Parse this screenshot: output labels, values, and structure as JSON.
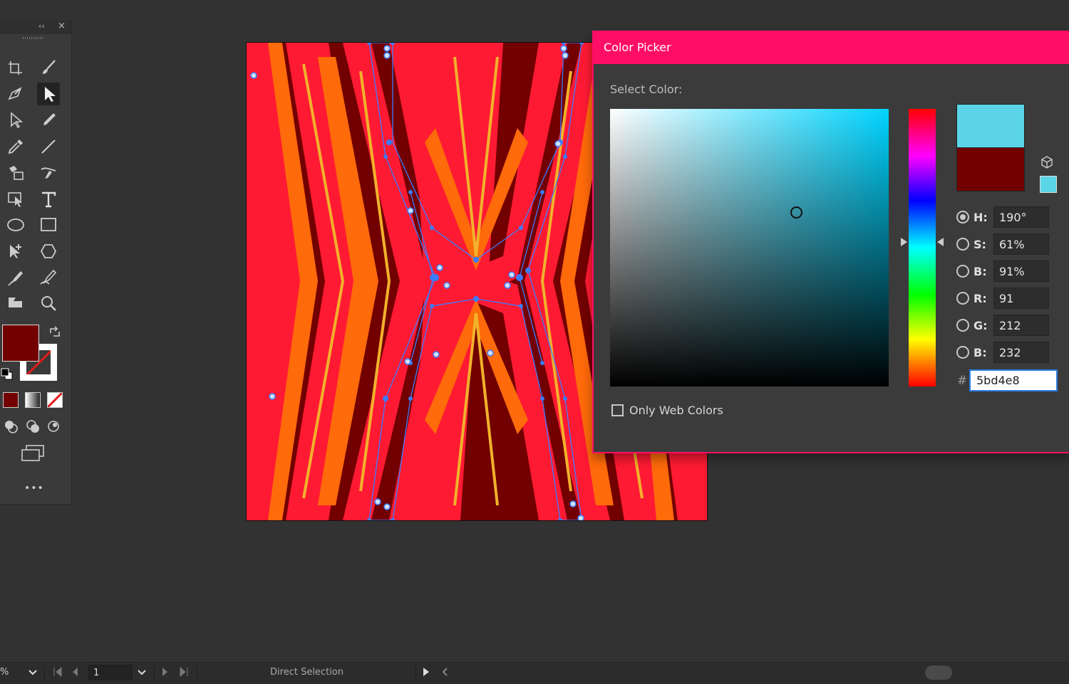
{
  "toolbar": {
    "collapse_label": "‹‹",
    "close_label": "×",
    "more_label": "•••",
    "fill_color": "#720000",
    "stroke_color": "none",
    "tools": [
      "artboard-tool",
      "paintbrush-tool",
      "shaper-tool",
      "direct-selection-tool",
      "selection-tool",
      "pencil-tool",
      "eyedropper-tool",
      "line-tool",
      "live-paint-tool",
      "curvature-tool",
      "free-transform-tool",
      "type-tool",
      "ellipse-tool",
      "rectangle-tool",
      "anchor-point-tool",
      "polygon-tool",
      "pen-tool",
      "width-tool",
      "graph-tool",
      "zoom-tool"
    ]
  },
  "artboard": {
    "colors": {
      "background": "#720000",
      "primary": "#ff1a33",
      "secondary": "#ff6a0a",
      "accent": "#f2b12b",
      "path_handle": "#3b7cff"
    }
  },
  "color_picker": {
    "title": "Color Picker",
    "select_label": "Select Color:",
    "new_color": "#5bd4e8",
    "original_color": "#720000",
    "fields": [
      {
        "key": "H",
        "label": "H:",
        "value": "190°",
        "selected": true
      },
      {
        "key": "S",
        "label": "S:",
        "value": "61%",
        "selected": false
      },
      {
        "key": "B",
        "label": "B:",
        "value": "91%",
        "selected": false
      },
      {
        "key": "R",
        "label": "R:",
        "value": "91",
        "selected": false
      },
      {
        "key": "G",
        "label": "G:",
        "value": "212",
        "selected": false
      },
      {
        "key": "B2",
        "label": "B:",
        "value": "232",
        "selected": false
      }
    ],
    "hex_label": "#",
    "hex_value": "5bd4e8",
    "only_web_colors_label": "Only Web Colors",
    "only_web_colors_checked": false,
    "accent_color": "#ff0e65"
  },
  "statusbar": {
    "zoom_text": "%",
    "page_value": "1",
    "current_tool": "Direct Selection"
  }
}
